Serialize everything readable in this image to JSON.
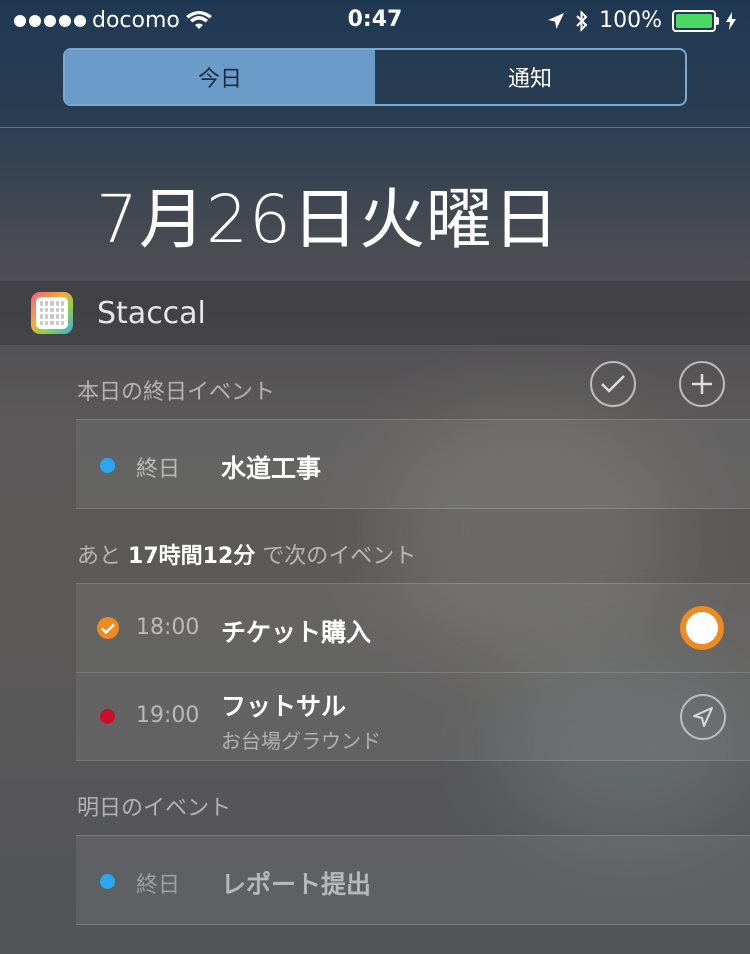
{
  "status_bar": {
    "carrier": "docomo",
    "time": "0:47",
    "battery": "100%",
    "battery_level": 1.0,
    "signal_bars": 5
  },
  "segmented_control": {
    "tabs": [
      {
        "label": "今日",
        "active": true
      },
      {
        "label": "通知",
        "active": false
      }
    ]
  },
  "date_heading": "7月26日火曜日",
  "widget": {
    "app_name": "Staccal",
    "all_day_section": {
      "label": "本日の終日イベント",
      "events": [
        {
          "time": "終日",
          "title": "水道工事",
          "dot_color": "#2aa7f0"
        }
      ]
    },
    "next_section": {
      "prefix": "あと",
      "countdown": "17時間12分",
      "suffix": "で次のイベント",
      "events": [
        {
          "time": "18:00",
          "title": "チケット購入",
          "completed": true,
          "accent": "#ef8a20"
        },
        {
          "time": "19:00",
          "title": "フットサル",
          "location": "お台場グラウンド",
          "dot_color": "#c8102e"
        }
      ]
    },
    "tomorrow_section": {
      "label": "明日のイベント",
      "events": [
        {
          "time": "終日",
          "title": "レポート提出",
          "dot_color": "#2aa7f0"
        }
      ]
    }
  },
  "icons": [
    "signal-dots-icon",
    "wifi-icon",
    "location-arrow-icon",
    "bluetooth-icon",
    "battery-icon",
    "charging-bolt-icon",
    "checkmark-icon",
    "plus-icon",
    "navigate-icon"
  ]
}
